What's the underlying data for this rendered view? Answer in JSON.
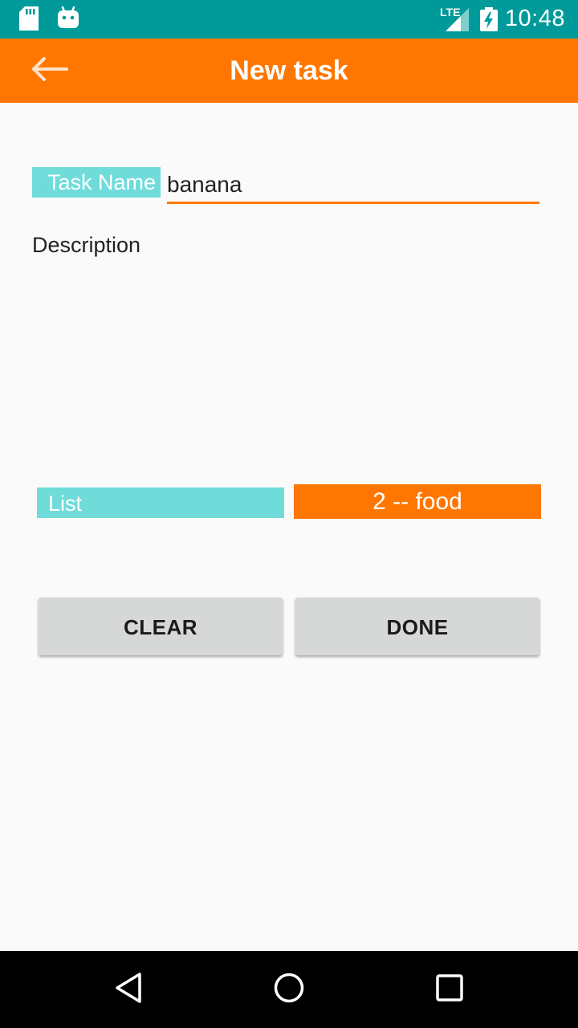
{
  "status_bar": {
    "time": "10:48",
    "network_label": "LTE",
    "left_icons": [
      "sd-card-icon",
      "android-icon"
    ],
    "right_icons": [
      "signal-icon",
      "battery-charging-icon"
    ]
  },
  "app_bar": {
    "title": "New task",
    "back_icon": "arrow-back-icon",
    "color": "#ff7700"
  },
  "form": {
    "task_name_label": "Task Name",
    "task_name_value": "banana",
    "description_placeholder": "Description",
    "list_label": "List",
    "list_selected": "2 -- food"
  },
  "buttons": {
    "clear": "CLEAR",
    "done": "DONE"
  },
  "nav_bar": {
    "icons": [
      "back-triangle-icon",
      "home-circle-icon",
      "recents-square-icon"
    ]
  },
  "colors": {
    "status_bar": "#009a9a",
    "accent": "#ff7700",
    "label_bg": "#70dcda",
    "button_bg": "#d6d7d7"
  }
}
